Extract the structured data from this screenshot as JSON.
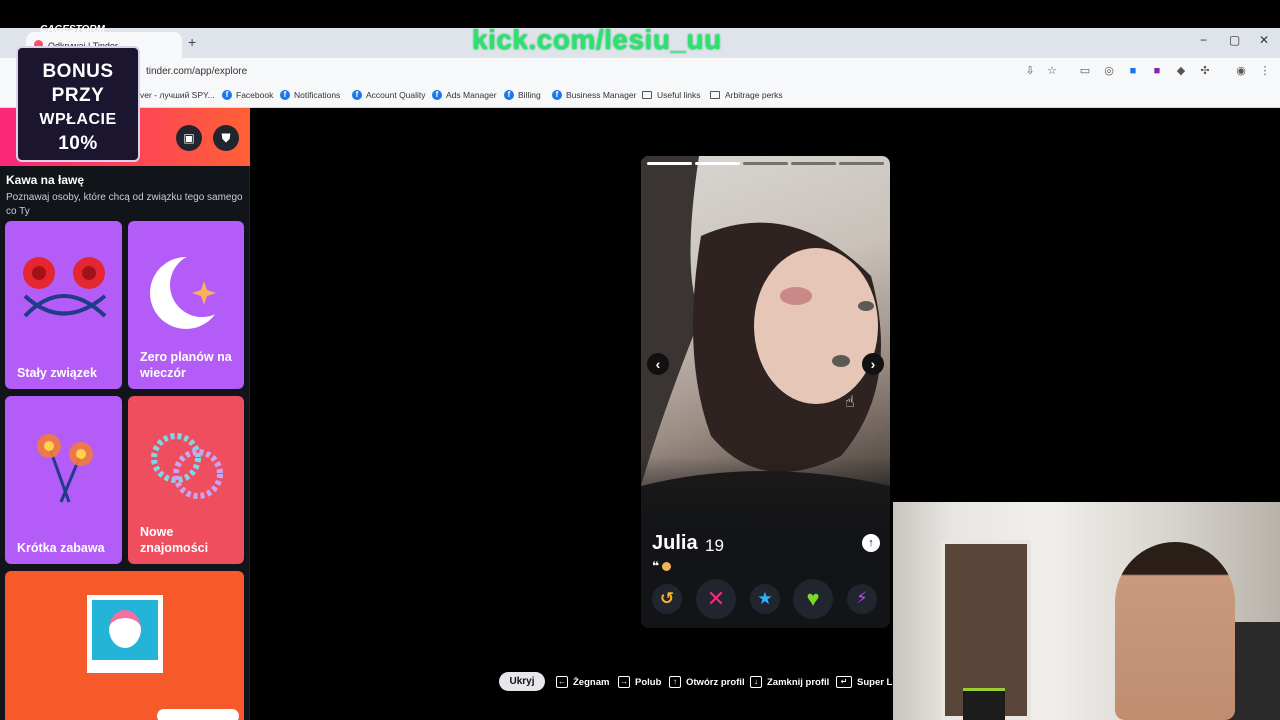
{
  "overlay": {
    "stream_url": "kick.com/lesiu_uu",
    "cage_text": "CAGESTORM",
    "bonus_lines": [
      "BONUS",
      "PRZY",
      "WPŁACIE",
      "10%"
    ]
  },
  "browser": {
    "tab_title": "Odkrywaj | Tinder",
    "new_tab": "+",
    "url": "tinder.com/app/explore",
    "window_controls": [
      "−",
      "▢",
      "✕"
    ],
    "bookmarks": [
      {
        "label": "ver - лучший SPY...",
        "icon": "none"
      },
      {
        "label": "Facebook",
        "icon": "facebook-icon"
      },
      {
        "label": "Notifications",
        "icon": "facebook-icon"
      },
      {
        "label": "Account Quality",
        "icon": "facebook-icon"
      },
      {
        "label": "Ads Manager",
        "icon": "facebook-icon"
      },
      {
        "label": "Billing",
        "icon": "facebook-icon"
      },
      {
        "label": "Business Manager",
        "icon": "facebook-icon"
      },
      {
        "label": "Useful links",
        "icon": "folder-icon"
      },
      {
        "label": "Arbitrage perks",
        "icon": "folder-icon"
      }
    ]
  },
  "sidebar": {
    "header_colors": [
      "#fd267a",
      "#ff6036"
    ],
    "section_title": "Kawa na ławę",
    "section_desc": "Poznawaj osoby, które chcą od związku tego samego co Ty",
    "cards": [
      {
        "label": "Stały związek",
        "color": "#b45cf7"
      },
      {
        "label": "Zero planów na wieczór",
        "color": "#b45cf7"
      },
      {
        "label": "Krótka zabawa",
        "color": "#b45cf7"
      },
      {
        "label": "Nowe znajomości",
        "color": "#ef4e5e"
      },
      {
        "label": "",
        "color": "#f65a2b"
      }
    ]
  },
  "profile": {
    "name": "Julia",
    "age": "19",
    "quote_mark": "❝",
    "photo_count": 5,
    "active_photo": 1,
    "actions": [
      {
        "name": "rewind",
        "glyph": "↺",
        "color": "#f7b32b"
      },
      {
        "name": "nope",
        "glyph": "✕",
        "color": "#fd267a"
      },
      {
        "name": "super-like",
        "glyph": "★",
        "color": "#2db6ff"
      },
      {
        "name": "like",
        "glyph": "♥",
        "color": "#7cd62b"
      },
      {
        "name": "boost",
        "glyph": "⚡",
        "color": "#b857f7"
      }
    ]
  },
  "hotkeys": {
    "hide": "Ukryj",
    "items": [
      {
        "key": "←",
        "label": "Żegnam"
      },
      {
        "key": "→",
        "label": "Polub"
      },
      {
        "key": "↑",
        "label": "Otwórz profil"
      },
      {
        "key": "↓",
        "label": "Zamknij profil"
      },
      {
        "key": "↵",
        "label": "Super Li"
      }
    ]
  }
}
